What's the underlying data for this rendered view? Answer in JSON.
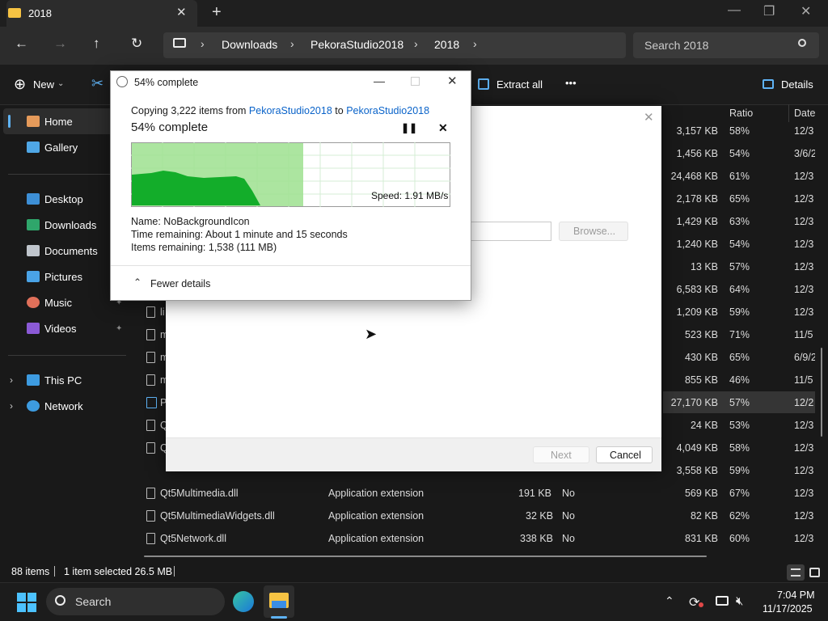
{
  "window": {
    "tab_title": "2018",
    "tab_close": "✕",
    "new_tab": "+",
    "minimize": "—",
    "maximize": "❐",
    "close": "✕"
  },
  "nav": {
    "back": "←",
    "forward": "→",
    "up": "↑",
    "refresh": "↻",
    "breadcrumbs": [
      "Downloads",
      "PekoraStudio2018",
      "2018"
    ],
    "search_placeholder": "Search 2018"
  },
  "toolbar": {
    "new_label": "New",
    "extract_label": "Extract all",
    "more_label": "•••",
    "details_label": "Details"
  },
  "sidebar": {
    "items": [
      {
        "label": "Home"
      },
      {
        "label": "Gallery"
      },
      {
        "label": "Desktop"
      },
      {
        "label": "Downloads"
      },
      {
        "label": "Documents"
      },
      {
        "label": "Pictures"
      },
      {
        "label": "Music"
      },
      {
        "label": "Videos"
      },
      {
        "label": "This PC"
      },
      {
        "label": "Network"
      }
    ]
  },
  "file_list": {
    "headers": {
      "ratio": "Ratio",
      "date": "Date"
    },
    "right_rows": [
      {
        "size": "3,157 KB",
        "ratio": "58%",
        "date": "12/3"
      },
      {
        "size": "1,456 KB",
        "ratio": "54%",
        "date": "3/6/2"
      },
      {
        "size": "24,468 KB",
        "ratio": "61%",
        "date": "12/3"
      },
      {
        "size": "2,178 KB",
        "ratio": "65%",
        "date": "12/3"
      },
      {
        "size": "1,429 KB",
        "ratio": "63%",
        "date": "12/3"
      },
      {
        "size": "1,240 KB",
        "ratio": "54%",
        "date": "12/3"
      },
      {
        "size": "13 KB",
        "ratio": "57%",
        "date": "12/3"
      },
      {
        "size": "6,583 KB",
        "ratio": "64%",
        "date": "12/3"
      },
      {
        "size": "1,209 KB",
        "ratio": "59%",
        "date": "12/3"
      },
      {
        "size": "523 KB",
        "ratio": "71%",
        "date": "11/5"
      },
      {
        "size": "430 KB",
        "ratio": "65%",
        "date": "6/9/2"
      },
      {
        "size": "855 KB",
        "ratio": "46%",
        "date": "11/5"
      },
      {
        "size": "27,170 KB",
        "ratio": "57%",
        "date": "12/2"
      },
      {
        "size": "24 KB",
        "ratio": "53%",
        "date": "12/3"
      },
      {
        "size": "4,049 KB",
        "ratio": "58%",
        "date": "12/3"
      },
      {
        "size": "3,558 KB",
        "ratio": "59%",
        "date": "12/3"
      },
      {
        "size": "569 KB",
        "ratio": "67%",
        "date": "12/3"
      },
      {
        "size": "82 KB",
        "ratio": "62%",
        "date": "12/3"
      },
      {
        "size": "831 KB",
        "ratio": "60%",
        "date": "12/3"
      }
    ],
    "left_partial": [
      "li",
      "m",
      "m",
      "m",
      "P",
      "Q",
      "Q"
    ],
    "bottom_rows": [
      {
        "name": "Qt5Multimedia.dll",
        "type": "Application extension",
        "packed": "191 KB",
        "pw": "No"
      },
      {
        "name": "Qt5MultimediaWidgets.dll",
        "type": "Application extension",
        "packed": "32 KB",
        "pw": "No"
      },
      {
        "name": "Qt5Network.dll",
        "type": "Application extension",
        "packed": "338 KB",
        "pw": "No"
      }
    ]
  },
  "status": {
    "count": "88 items",
    "selected": "1 item selected  26.5 MB"
  },
  "wizard": {
    "browse": "Browse...",
    "next": "Next",
    "cancel": "Cancel"
  },
  "copy_dialog": {
    "title": "54% complete",
    "copying_prefix": "Copying 3,222 items from",
    "source": "PekoraStudio2018",
    "to": "to",
    "dest": "PekoraStudio2018",
    "heading": "54% complete",
    "progress": 0.54,
    "speed": "Speed: 1.91 MB/s",
    "name": "Name:  NoBackgroundIcon",
    "time_remaining": "Time remaining:  About 1 minute and 15 seconds",
    "items_remaining": "Items remaining:  1,538 (111 MB)",
    "fewer_details": "Fewer details"
  },
  "taskbar": {
    "search_label": "Search",
    "time": "7:04 PM",
    "date": "11/17/2025"
  }
}
